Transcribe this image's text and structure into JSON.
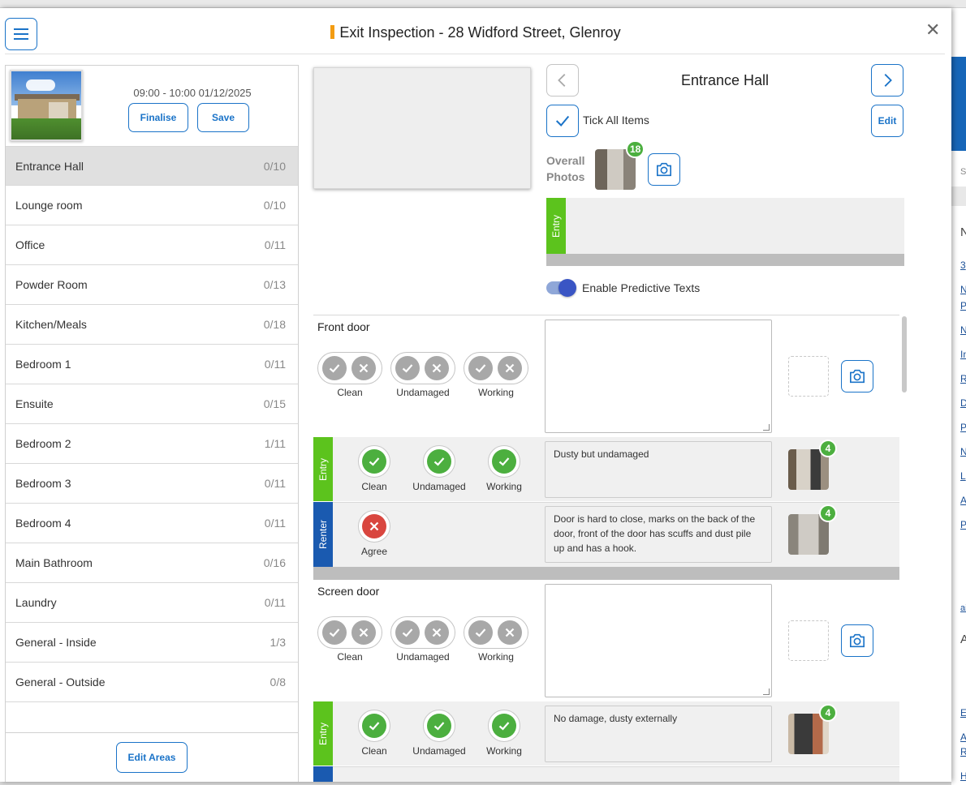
{
  "header": {
    "title": "Exit Inspection - 28 Widford Street, Glenroy",
    "accent_color": "#f39c12"
  },
  "inspection": {
    "time": "09:00 - 10:00 01/12/2025",
    "finalise_label": "Finalise",
    "save_label": "Save",
    "edit_areas_label": "Edit Areas"
  },
  "areas": [
    {
      "name": "Entrance Hall",
      "count": "0/10"
    },
    {
      "name": "Lounge room",
      "count": "0/10"
    },
    {
      "name": "Office",
      "count": "0/11"
    },
    {
      "name": "Powder Room",
      "count": "0/13"
    },
    {
      "name": "Kitchen/Meals",
      "count": "0/18"
    },
    {
      "name": "Bedroom 1",
      "count": "0/11"
    },
    {
      "name": "Ensuite",
      "count": "0/15"
    },
    {
      "name": "Bedroom 2",
      "count": "1/11"
    },
    {
      "name": "Bedroom 3",
      "count": "0/11"
    },
    {
      "name": "Bedroom 4",
      "count": "0/11"
    },
    {
      "name": "Main Bathroom",
      "count": "0/16"
    },
    {
      "name": "Laundry",
      "count": "0/11"
    },
    {
      "name": "General - Inside",
      "count": "1/3"
    },
    {
      "name": "General - Outside",
      "count": "0/8"
    }
  ],
  "area_panel": {
    "title": "Entrance Hall",
    "tick_all_label": "Tick All Items",
    "edit_label": "Edit",
    "overall_photos_label_1": "Overall",
    "overall_photos_label_2": "Photos",
    "overall_photos_count": "18",
    "entry_tag": "Entry",
    "predictive_label": "Enable Predictive Texts",
    "predictive_enabled": true
  },
  "items": [
    {
      "name": "Front door",
      "conditions": [
        "Clean",
        "Undamaged",
        "Working"
      ],
      "entry": {
        "tag": "Entry",
        "conditions": [
          "Clean",
          "Undamaged",
          "Working"
        ],
        "note": "Dusty but undamaged",
        "photo_count": "4"
      },
      "renter": {
        "tag": "Renter",
        "label": "Agree",
        "note": "Door is hard to close, marks on the back of the door, front of the door has scuffs and dust pile up and has a hook.",
        "photo_count": "4"
      }
    },
    {
      "name": "Screen door",
      "conditions": [
        "Clean",
        "Undamaged",
        "Working"
      ],
      "entry": {
        "tag": "Entry",
        "conditions": [
          "Clean",
          "Undamaged",
          "Working"
        ],
        "note": "No damage, dusty externally",
        "photo_count": "4"
      }
    }
  ],
  "colors": {
    "primary": "#1a73c8",
    "entry_tag": "#5cc31d",
    "renter_tag": "#1a5ab0",
    "ok": "#4caf3f",
    "bad": "#d9463f"
  }
}
